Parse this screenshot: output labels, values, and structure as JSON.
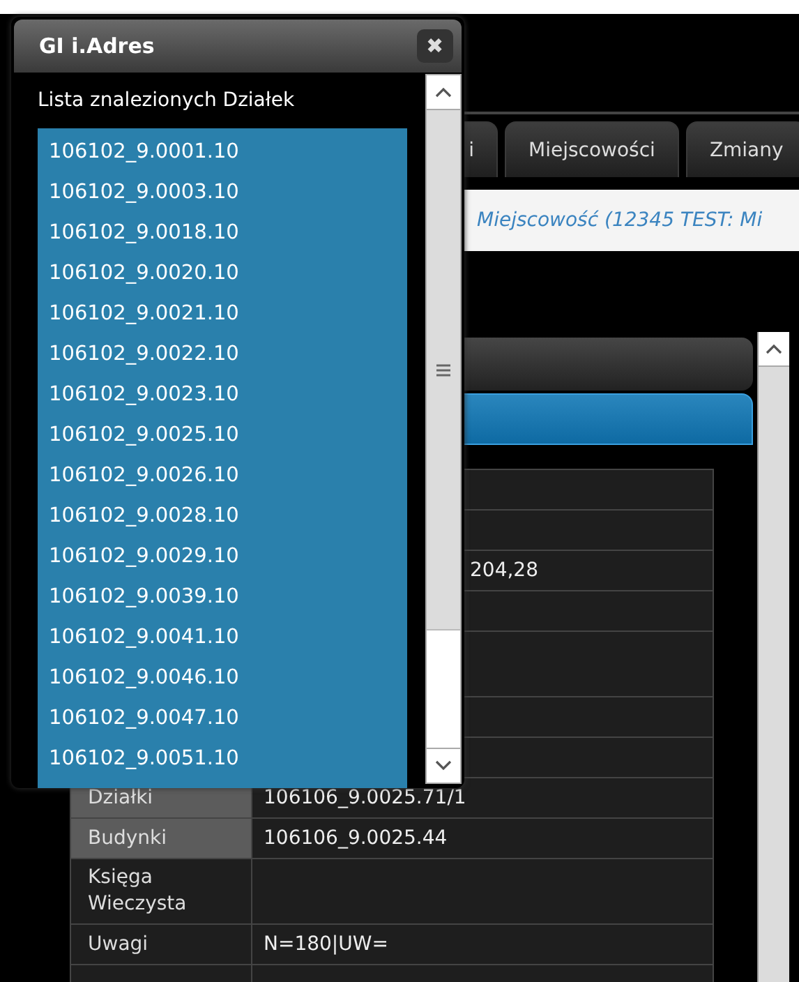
{
  "tabs": [
    {
      "label": "i",
      "selected": false
    },
    {
      "label": "Miejscowości",
      "selected": false
    },
    {
      "label": "Zmiany",
      "selected": false
    }
  ],
  "breadcrumb": "Miejscowość (12345 TEST: Mi",
  "table": {
    "rows": [
      {
        "kind": "covered"
      },
      {
        "kind": "covered"
      },
      {
        "kind": "covered",
        "value": "204,28"
      },
      {
        "kind": "covered"
      },
      {
        "kind": "double"
      },
      {
        "kind": "covered"
      },
      {
        "kind": "covered"
      },
      {
        "kind": "shaded",
        "label": "Działki",
        "value": "106106_9.0025.71/1"
      },
      {
        "kind": "shaded",
        "label": "Budynki",
        "value": "106106_9.0025.44"
      },
      {
        "kind": "plain",
        "label": "Księga Wieczysta"
      },
      {
        "kind": "plain",
        "label": "Uwagi",
        "value": "N=180|UW="
      },
      {
        "kind": "plain"
      }
    ]
  },
  "dialog": {
    "title": "GI i.Adres",
    "close": "✖",
    "heading": "Lista znalezionych Działek",
    "items": [
      "106102_9.0001.10",
      "106102_9.0003.10",
      "106102_9.0018.10",
      "106102_9.0020.10",
      "106102_9.0021.10",
      "106102_9.0022.10",
      "106102_9.0023.10",
      "106102_9.0025.10",
      "106102_9.0026.10",
      "106102_9.0028.10",
      "106102_9.0029.10",
      "106102_9.0039.10",
      "106102_9.0041.10",
      "106102_9.0046.10",
      "106102_9.0047.10",
      "106102_9.0051.10"
    ]
  }
}
